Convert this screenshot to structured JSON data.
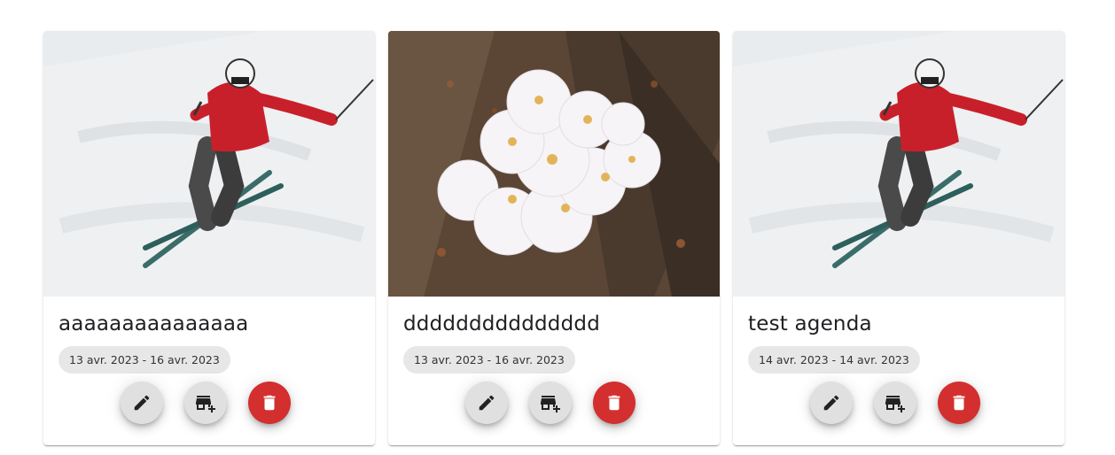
{
  "cards": [
    {
      "image": "skier-icon",
      "title": "aaaaaaaaaaaaaaa",
      "dates": "13 avr. 2023 - 16 avr. 2023",
      "actions": {
        "edit": "edit-icon",
        "add": "add-business-icon",
        "delete": "delete-icon"
      }
    },
    {
      "image": "blossom-icon",
      "title": "ddddddddddddddd",
      "dates": "13 avr. 2023 - 16 avr. 2023",
      "actions": {
        "edit": "edit-icon",
        "add": "add-business-icon",
        "delete": "delete-icon"
      }
    },
    {
      "image": "skier-icon",
      "title": "test agenda",
      "dates": "14 avr. 2023 - 14 avr. 2023",
      "actions": {
        "edit": "edit-icon",
        "add": "add-business-icon",
        "delete": "delete-icon"
      }
    }
  ],
  "colors": {
    "delete": "#d32f2f",
    "fab": "#e0e0e0",
    "chip": "#e7e7e7"
  }
}
